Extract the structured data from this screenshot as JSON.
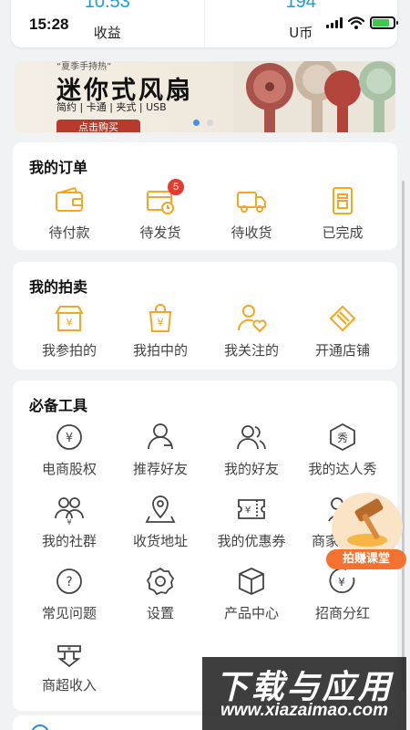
{
  "status_bar": {
    "time": "15:28"
  },
  "stats": [
    {
      "value": "10.53",
      "label": "收益"
    },
    {
      "value": "194",
      "label": "U币"
    }
  ],
  "banner": {
    "tag": "“夏季手持热”",
    "title": "迷你式风扇",
    "subtitle": "简约 | 卡通 | 夹式 | USB",
    "button": "点击购买",
    "slides": 2,
    "active_slide": 1
  },
  "orders": {
    "title": "我的订单",
    "items": [
      {
        "label": "待付款",
        "icon": "wallet-icon"
      },
      {
        "label": "待发货",
        "icon": "pending-shipment-icon",
        "badge": "5"
      },
      {
        "label": "待收货",
        "icon": "delivery-truck-icon"
      },
      {
        "label": "已完成",
        "icon": "completed-receipt-icon"
      }
    ]
  },
  "auction": {
    "title": "我的拍卖",
    "items": [
      {
        "label": "我参拍的",
        "icon": "shop-icon"
      },
      {
        "label": "我拍中的",
        "icon": "shopping-bag-icon"
      },
      {
        "label": "我关注的",
        "icon": "heart-user-icon"
      },
      {
        "label": "开通店铺",
        "icon": "open-store-icon"
      }
    ]
  },
  "tools": {
    "title": "必备工具",
    "items": [
      {
        "label": "电商股权",
        "icon": "yuan-coin-icon"
      },
      {
        "label": "推荐好友",
        "icon": "recommend-friend-icon"
      },
      {
        "label": "我的好友",
        "icon": "friends-icon"
      },
      {
        "label": "我的达人秀",
        "icon": "show-icon"
      },
      {
        "label": "我的社群",
        "icon": "community-icon"
      },
      {
        "label": "收货地址",
        "icon": "location-pin-icon"
      },
      {
        "label": "我的优惠券",
        "icon": "coupon-icon"
      },
      {
        "label": "商家",
        "icon": "merchant-icon"
      },
      {
        "label": "常见问题",
        "icon": "question-icon"
      },
      {
        "label": "设置",
        "icon": "settings-gear-icon"
      },
      {
        "label": "产品中心",
        "icon": "product-box-icon"
      },
      {
        "label": "招商分红",
        "icon": "dividend-icon"
      },
      {
        "label": "商超收入",
        "icon": "income-icon"
      }
    ]
  },
  "float_promo": {
    "label": "拍赚课堂",
    "icon": "auction-hammer-icon"
  },
  "watermark": {
    "title": "下载与应用",
    "url": "www.xiazaimao.com"
  },
  "colors": {
    "accent_orange": "#f5a623",
    "stat_blue": "#1e9ec9",
    "badge_red": "#e43b30",
    "icon_dark": "#444444"
  }
}
